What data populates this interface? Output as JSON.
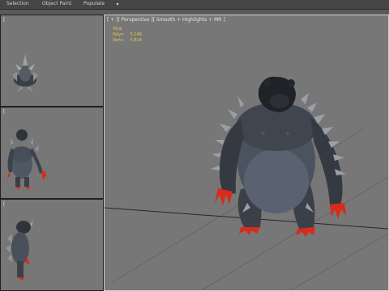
{
  "menubar": {
    "items": [
      "Selection",
      "Object Paint",
      "Populate"
    ],
    "dropdown_label": "▾"
  },
  "viewports": {
    "top": {
      "label": "[ "
    },
    "front": {
      "label": "[ "
    },
    "left": {
      "label": "[ "
    },
    "perspective": {
      "label": "[ + ][ Perspective ][ Smooth + Highlights + MR ]",
      "stats": {
        "header": "Total",
        "polys_label": "Polys:",
        "polys_value": "5,148",
        "verts_label": "Verts:",
        "verts_value": "5,814"
      }
    }
  },
  "colors": {
    "viewport_bg": "#777777",
    "active_border": "#cfcfcf",
    "stats_text": "#e8c84a",
    "claw_red": "#d92a1a"
  }
}
